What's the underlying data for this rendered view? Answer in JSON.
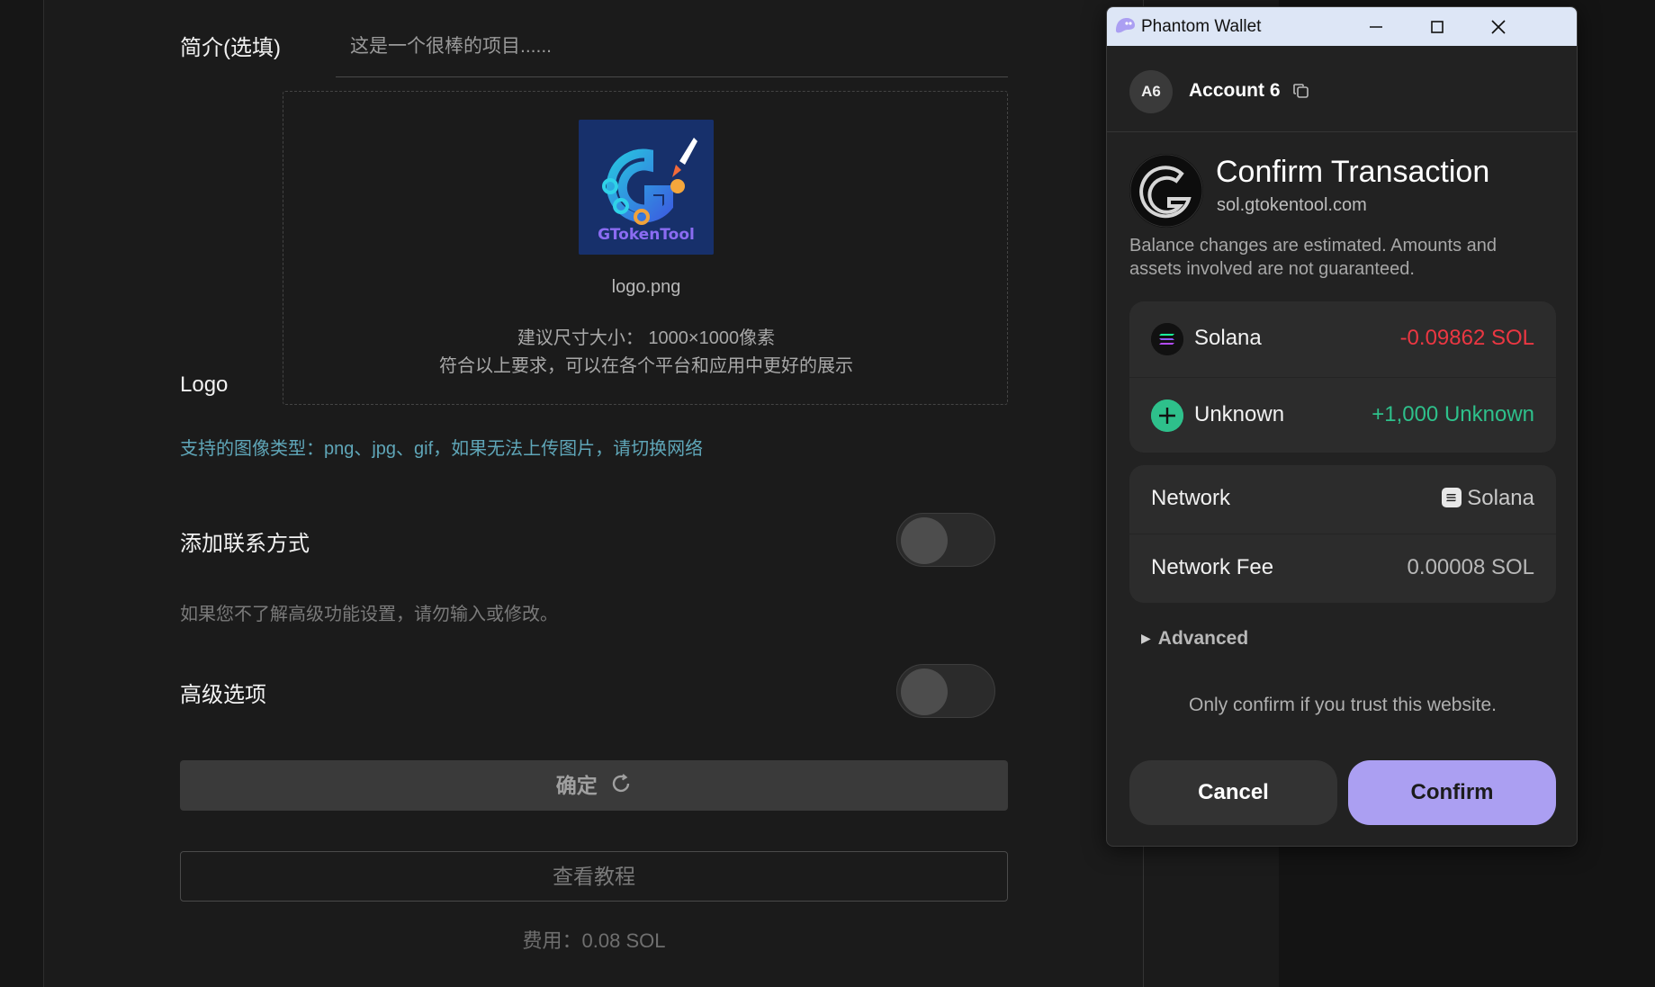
{
  "form": {
    "intro_label": "简介(选填)",
    "intro_placeholder": "这是一个很棒的项目......",
    "logo_label": "Logo",
    "logo_brand_text": "GTokenTool",
    "logo_file_name": "logo.png",
    "size_hint": "建议尺寸大小： 1000×1000像素",
    "size_hint_2": "符合以上要求，可以在各个平台和应用中更好的展示",
    "supported_types": "支持的图像类型：png、jpg、gif，如果无法上传图片，请切换网络",
    "contact_label": "添加联系方式",
    "advanced_note": "如果您不了解高级功能设置，请勿输入或修改。",
    "advanced_label": "高级选项",
    "confirm_label": "确定",
    "tutorial_label": "查看教程",
    "fee_text": "费用：0.08 SOL"
  },
  "popup": {
    "window_title": "Phantom Wallet",
    "account_initials": "A6",
    "account_name": "Account 6",
    "tx_title": "Confirm Transaction",
    "tx_site": "sol.gtokentool.com",
    "tx_note": "Balance changes are estimated. Amounts and assets involved are not guaranteed.",
    "balance_changes": [
      {
        "label": "Solana",
        "value": "-0.09862 SOL",
        "color": "#eb3742"
      },
      {
        "label": "Unknown",
        "value": "+1,000 Unknown",
        "color": "#2ec08b"
      }
    ],
    "details": [
      {
        "label": "Network",
        "value": "Solana"
      },
      {
        "label": "Network Fee",
        "value": "0.00008 SOL"
      }
    ],
    "advanced_label": "Advanced",
    "trust_note": "Only confirm if you trust this website.",
    "cancel_label": "Cancel",
    "confirm_label": "Confirm",
    "accent_color": "#ab9ff2"
  }
}
